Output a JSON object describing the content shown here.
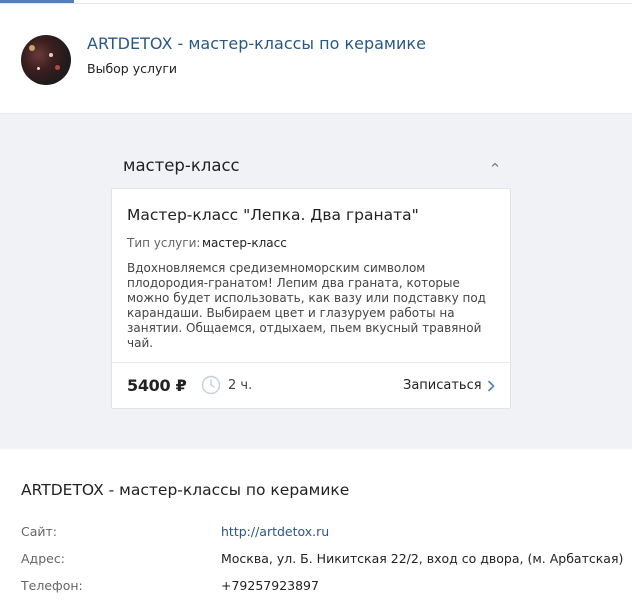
{
  "header": {
    "title": "ARTDETOX - мастер-классы по керамике",
    "subtitle": "Выбор услуги"
  },
  "section": {
    "title": "мастер-класс"
  },
  "service_card": {
    "title": "Мастер-класс \"Лепка. Два граната\"",
    "type_label": "Тип услуги:",
    "type_value": "мастер-класс",
    "description": "Вдохновляемся средиземноморским символом плодородия-гранатом! Лепим два граната, которые можно будет использовать, как вазу или подставку под карандаши. Выбираем цвет и глазуруем работы на занятии. Общаемся, отдыхаем, пьем вкусный травяной чай.",
    "price": "5400 ₽",
    "duration": "2 ч.",
    "book_label": "Записаться"
  },
  "info": {
    "title": "ARTDETOX - мастер-классы по керамике",
    "site_label": "Сайт:",
    "site_value": "http://artdetox.ru",
    "address_label": "Адрес:",
    "address_value": "Москва, ул. Б. Никитская 22/2, вход со двора, (м. Арбатская)",
    "phone_label": "Телефон:",
    "phone_value": "+79257923897"
  },
  "colors": {
    "link": "#2a5885",
    "accent": "#5181b8",
    "background_gray": "#f0f2f5"
  },
  "icons": [
    "chevron-up-icon",
    "clock-icon",
    "chevron-right-icon"
  ]
}
